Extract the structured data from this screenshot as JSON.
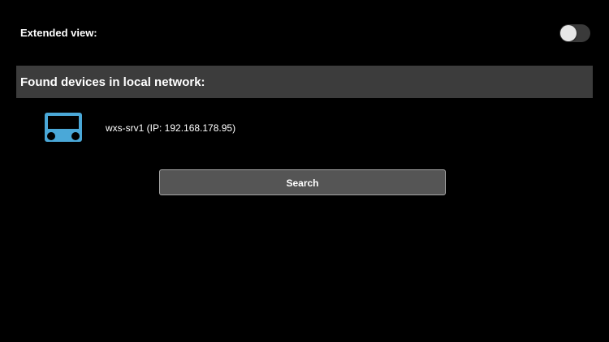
{
  "settings": {
    "extended_view_label": "Extended view:",
    "extended_view_enabled": false
  },
  "devices_section": {
    "title": "Found devices in local network:",
    "devices": [
      {
        "label": "wxs-srv1 (IP: 192.168.178.95)",
        "icon": "device-icon",
        "icon_color": "#4aa8d8"
      }
    ]
  },
  "actions": {
    "search_label": "Search"
  },
  "colors": {
    "background": "#000000",
    "header_background": "#3c3c3c",
    "button_background": "#555555",
    "accent": "#4aa8d8"
  }
}
